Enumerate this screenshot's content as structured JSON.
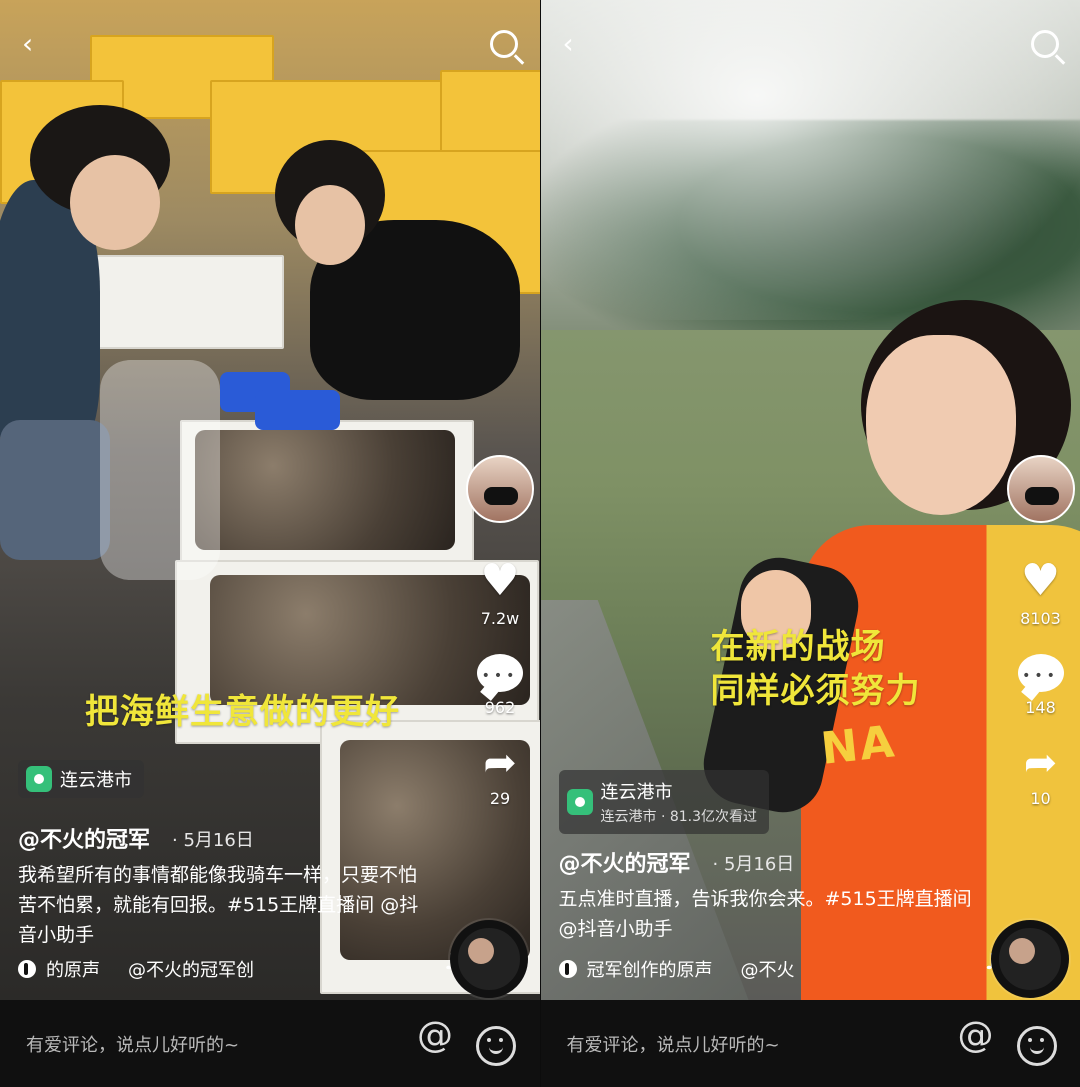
{
  "panels": [
    {
      "subtitle": "把海鲜生意做的更好",
      "location": "连云港市",
      "author": "@不火的冠军",
      "date": "· 5月16日",
      "description": "我希望所有的事情都能像我骑车一样，只要不怕苦不怕累，就能有回报。#515王牌直播间 @抖音小助手",
      "music_text": "的原声",
      "music_author": "@不火的冠军创",
      "rail": {
        "likes": "7.2w",
        "comments": "962",
        "shares": "29"
      },
      "comment_placeholder": "有爱评论，说点儿好听的~"
    },
    {
      "subtitle_line1": "在新的战场",
      "subtitle_line2": "同样必须努力",
      "location": "连云港市",
      "location_sub": "连云港市 · 81.3亿次看过",
      "author": "@不火的冠军",
      "date": "· 5月16日",
      "description": "五点准时直播，告诉我你会来。#515王牌直播间 @抖音小助手",
      "music_text": "冠军创作的原声",
      "music_author": "@不火",
      "rail": {
        "likes": "8103",
        "comments": "148",
        "shares": "10"
      },
      "comment_placeholder": "有爱评论，说点儿好听的~",
      "jersey_text": "NA"
    }
  ],
  "icons": [
    "back-icon",
    "search-icon",
    "heart-icon",
    "comment-icon",
    "share-icon",
    "music-disc-icon",
    "at-icon",
    "emoji-icon",
    "location-pin-icon",
    "tiktok-note-icon"
  ]
}
